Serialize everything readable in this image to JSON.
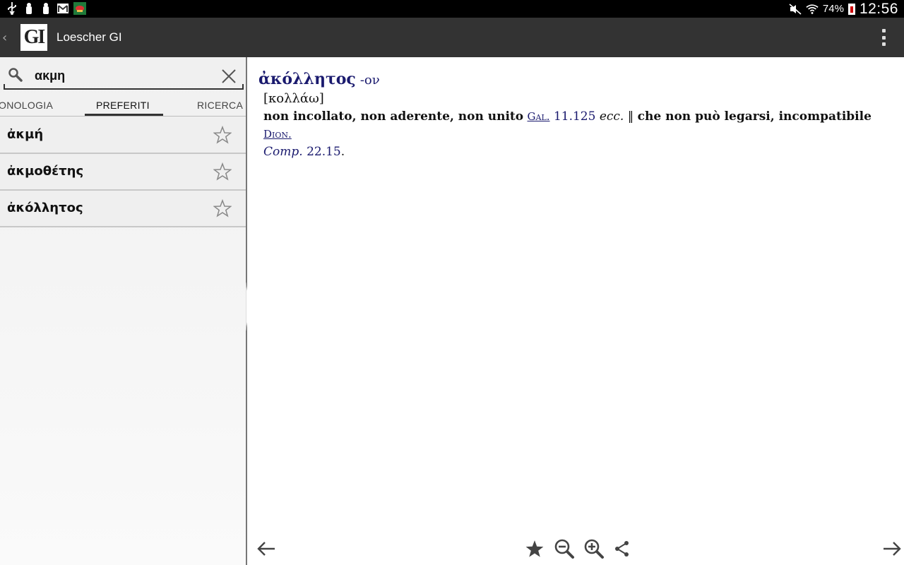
{
  "status_bar": {
    "battery_percent": "74%",
    "time": "12:56",
    "icons": [
      "usb-icon",
      "download-icon",
      "download-icon",
      "gmail-icon",
      "app-notification-icon",
      "mute-icon",
      "wifi-icon",
      "battery-icon"
    ]
  },
  "app_bar": {
    "logo_text": "GI",
    "title": "Loescher GI"
  },
  "search": {
    "value": "ακμη",
    "placeholder": ""
  },
  "tabs": [
    {
      "label": "ONOLOGIA",
      "active": false
    },
    {
      "label": "PREFERITI",
      "active": true
    },
    {
      "label": "RICERCA",
      "active": false
    }
  ],
  "favorites": [
    {
      "label": "ἀκμή"
    },
    {
      "label": "ἀκμοθέτης"
    },
    {
      "label": "ἀκόλλητος"
    }
  ],
  "entry": {
    "headword": "ἀκόλλητος",
    "suffix": "-ον",
    "etymology": "[κολλάω]",
    "def_part1": "non incollato, non aderente, non unito",
    "ref1_author": "Gal.",
    "ref1_loc": "11.125",
    "ecc": "ecc.",
    "separator": "‖",
    "def_part2": "che non può legarsi, incompatibile",
    "ref2_author": "Dion.",
    "ref2_work": "Comp.",
    "ref2_loc": "22.15",
    "end": "."
  },
  "colors": {
    "accent": "#1a1a6e",
    "actionbar": "#333333"
  }
}
